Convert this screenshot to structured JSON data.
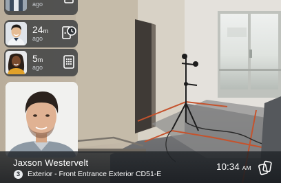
{
  "events": [
    {
      "id": "top",
      "value": "",
      "unit": "",
      "ago": "ago",
      "icon": "door-icon",
      "avatar": "person-avatar-top"
    },
    {
      "id": "e1",
      "value": "24",
      "unit": "m",
      "ago": "ago",
      "icon": "door-clock-icon",
      "avatar": "person-avatar-asian-man"
    },
    {
      "id": "e2",
      "value": "5",
      "unit": "m",
      "ago": "ago",
      "icon": "keypad-icon",
      "avatar": "person-avatar-man-dreadlocks"
    }
  ],
  "detection": {
    "name": "Jaxson Westervelt",
    "count": "3",
    "location": "Exterior - Front Entrance Exterior CD51-E",
    "time": "10:34",
    "ampm": "AM"
  },
  "colors": {
    "overlay": "#2c3034",
    "badge_bg": "#e9ebee",
    "text": "#ffffff",
    "subtext": "#c7cbd0"
  }
}
